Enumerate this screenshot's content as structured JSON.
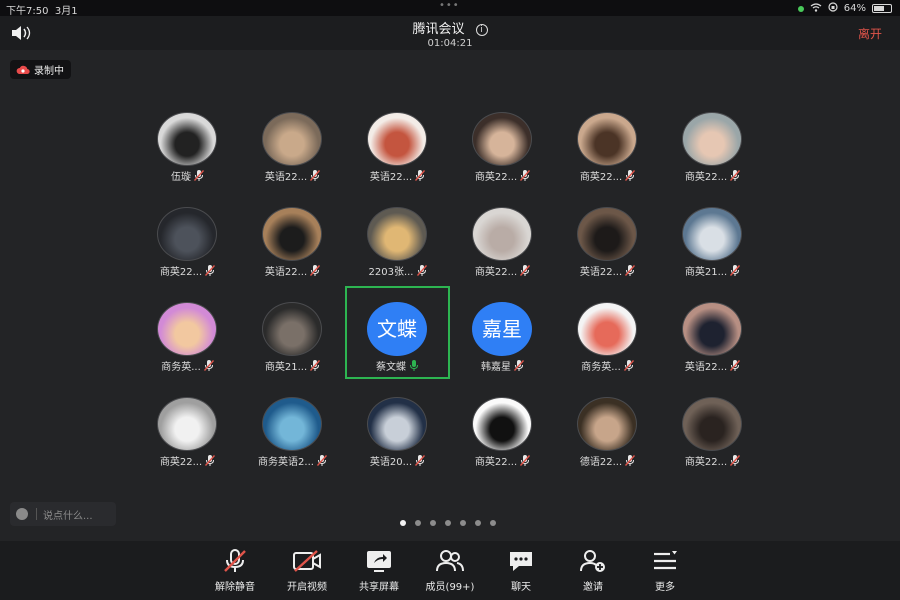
{
  "status_bar": {
    "time": "下午7:50",
    "date": "3月1",
    "battery": "64%",
    "battery_level": 0.64
  },
  "header": {
    "title": "腾讯会议",
    "duration": "01:04:21",
    "leave_label": "离开"
  },
  "recording_label": "录制中",
  "participants": [
    {
      "name": "伍璇",
      "mic": "muted",
      "avatar": "photo-helmet"
    },
    {
      "name": "英语22...",
      "mic": "muted",
      "avatar": "photo-child"
    },
    {
      "name": "英语22...",
      "mic": "muted",
      "avatar": "photo-anime-redhair"
    },
    {
      "name": "商英22...",
      "mic": "muted",
      "avatar": "photo-girl"
    },
    {
      "name": "商英22...",
      "mic": "muted",
      "avatar": "photo-child-smile"
    },
    {
      "name": "商英22...",
      "mic": "muted",
      "avatar": "photo-baby"
    },
    {
      "name": "商英22...",
      "mic": "muted",
      "avatar": "photo-dark"
    },
    {
      "name": "英语22...",
      "mic": "muted",
      "avatar": "photo-sunset"
    },
    {
      "name": "2203张...",
      "mic": "muted",
      "avatar": "photo-dog"
    },
    {
      "name": "商英22...",
      "mic": "muted",
      "avatar": "photo-anime-white"
    },
    {
      "name": "英语22...",
      "mic": "muted",
      "avatar": "photo-girl-bangs"
    },
    {
      "name": "商英21...",
      "mic": "muted",
      "avatar": "photo-sea"
    },
    {
      "name": "商务英...",
      "mic": "muted",
      "avatar": "photo-pink-cartoon"
    },
    {
      "name": "商英21...",
      "mic": "muted",
      "avatar": "photo-car"
    },
    {
      "name": "蔡文蝶",
      "mic": "active",
      "avatar_text": "文蝶",
      "highlighted": true
    },
    {
      "name": "韩嘉星",
      "mic": "muted",
      "avatar_text": "嘉星"
    },
    {
      "name": "商务英...",
      "mic": "muted",
      "avatar": "photo-sheep-cartoon"
    },
    {
      "name": "英语22...",
      "mic": "muted",
      "avatar": "photo-girl-cap"
    },
    {
      "name": "商英22...",
      "mic": "muted",
      "avatar": "photo-cat-drawing"
    },
    {
      "name": "商务英语2...",
      "mic": "muted",
      "avatar": "photo-cartoon-blue"
    },
    {
      "name": "英语20...",
      "mic": "muted",
      "avatar": "photo-swan"
    },
    {
      "name": "商英22...",
      "mic": "muted",
      "avatar": "photo-cartoon-bun"
    },
    {
      "name": "德语22...",
      "mic": "muted",
      "avatar": "photo-boy-dark"
    },
    {
      "name": "商英22...",
      "mic": "muted",
      "avatar": "photo-boy"
    }
  ],
  "chat": {
    "placeholder": "说点什么..."
  },
  "pager": {
    "pages": 7,
    "current": 1
  },
  "toolbar": [
    {
      "label": "解除静音",
      "icon": "mic-muted-icon"
    },
    {
      "label": "开启视频",
      "icon": "video-off-icon"
    },
    {
      "label": "共享屏幕",
      "icon": "share-screen-icon"
    },
    {
      "label": "成员(99+)",
      "icon": "members-icon"
    },
    {
      "label": "聊天",
      "icon": "chat-icon"
    },
    {
      "label": "邀请",
      "icon": "invite-icon"
    },
    {
      "label": "更多",
      "icon": "more-icon"
    }
  ],
  "colors": {
    "accent_blue": "#2f7ff5",
    "speaking_green": "#2db551",
    "leave_red": "#e0544a",
    "mute_red": "#e0544a"
  }
}
